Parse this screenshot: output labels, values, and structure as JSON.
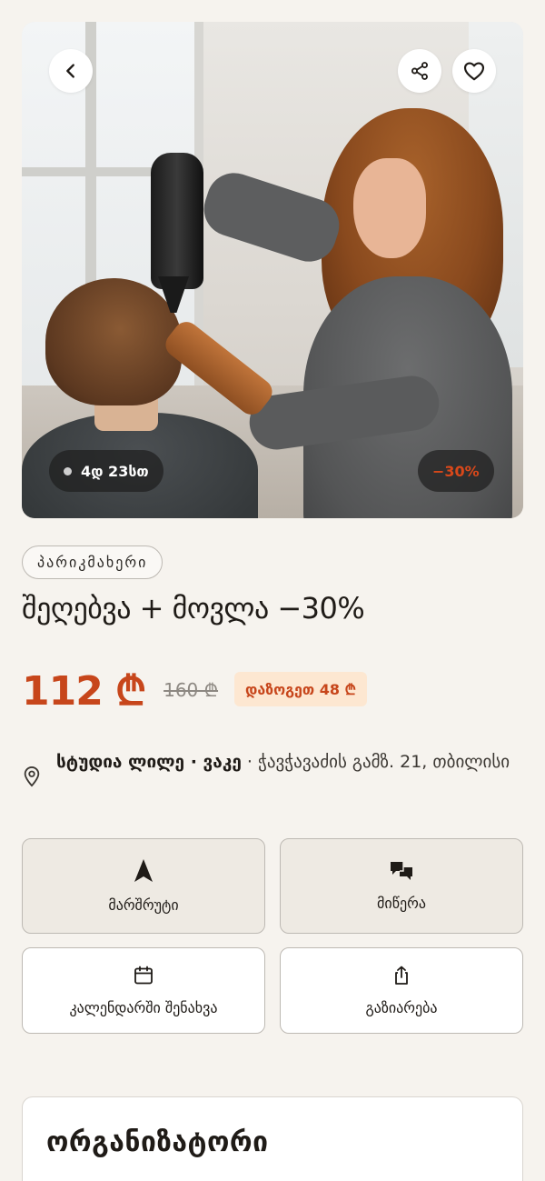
{
  "hero": {
    "timer_text": "4დ 23სთ",
    "discount_badge": "−30%",
    "back_icon": "chevron-left-icon",
    "share_icon": "share-icon",
    "favorite_icon": "heart-icon"
  },
  "category": "პარიკმახერი",
  "title": "შეღებვა + მოვლა −30%",
  "price": {
    "current": "112 ₾",
    "old": "160 ₾",
    "savings": "დაზოგეთ 48 ₾"
  },
  "location": {
    "venue": "სტუდია ლილე · ვაკე",
    "separator": " · ",
    "address": "ჭავჭავაძის გამზ. 21, თბილისი"
  },
  "actions": [
    {
      "label": "მარშრუტი",
      "icon": "navigation-arrow-icon"
    },
    {
      "label": "მიწერა",
      "icon": "chat-icon"
    },
    {
      "label": "კალენდარში შენახვა",
      "icon": "calendar-icon"
    },
    {
      "label": "გაზიარება",
      "icon": "share-upload-icon"
    }
  ],
  "organizer": {
    "heading": "ორგანიზატორი"
  },
  "colors": {
    "accent": "#c7461b",
    "background": "#f6f3ee",
    "savings_bg": "#fde7d1"
  }
}
